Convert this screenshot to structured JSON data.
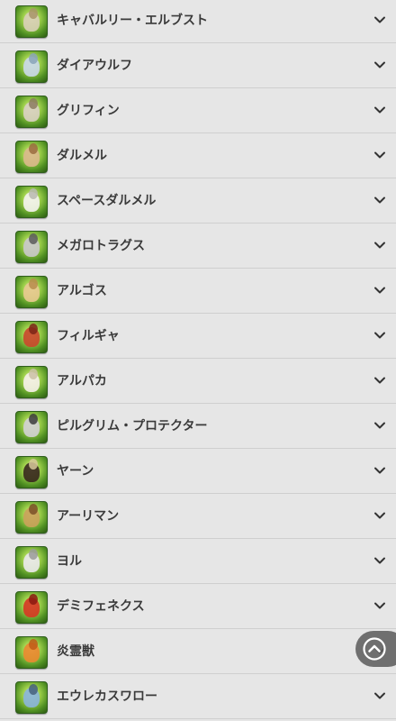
{
  "mounts": [
    {
      "name": "キャバルリー・エルブスト",
      "icon": "elbst-icon",
      "colors": [
        "#d7cfb4",
        "#a89468"
      ]
    },
    {
      "name": "ダイアウルフ",
      "icon": "direwolf-icon",
      "colors": [
        "#c9d8e6",
        "#8aa3b8"
      ]
    },
    {
      "name": "グリフィン",
      "icon": "griffin-icon",
      "colors": [
        "#d8d0c0",
        "#8c7b60"
      ]
    },
    {
      "name": "ダルメル",
      "icon": "dhalmel-icon",
      "colors": [
        "#d9b98a",
        "#9a6c40"
      ]
    },
    {
      "name": "スペースダルメル",
      "icon": "space-dhalmel-icon",
      "colors": [
        "#f2f2ec",
        "#b8b8b0"
      ]
    },
    {
      "name": "メガロトラグス",
      "icon": "megalotragus-icon",
      "colors": [
        "#c8c8c8",
        "#5a5a5a"
      ]
    },
    {
      "name": "アルゴス",
      "icon": "argos-icon",
      "colors": [
        "#e6c98e",
        "#b88c4c"
      ]
    },
    {
      "name": "フィルギャ",
      "icon": "fylgja-icon",
      "colors": [
        "#c84a2c",
        "#7a2416"
      ]
    },
    {
      "name": "アルパカ",
      "icon": "alpaca-icon",
      "colors": [
        "#f4f0e6",
        "#cbbfa6"
      ]
    },
    {
      "name": "ピルグリム・プロテクター",
      "icon": "pilgrim-protector-icon",
      "colors": [
        "#d0d0d0",
        "#3c3c3c"
      ]
    },
    {
      "name": "ヤーン",
      "icon": "yarn-icon",
      "colors": [
        "#3a2a1e",
        "#d8c89a"
      ]
    },
    {
      "name": "アーリマン",
      "icon": "ahriman-icon",
      "colors": [
        "#c9a25a",
        "#7a5028"
      ]
    },
    {
      "name": "ヨル",
      "icon": "yol-icon",
      "colors": [
        "#e8e8e8",
        "#9a9a9a"
      ]
    },
    {
      "name": "デミフェネクス",
      "icon": "demi-phoenix-icon",
      "colors": [
        "#d43a24",
        "#8a1a10"
      ]
    },
    {
      "name": "炎霊獣",
      "icon": "flame-spirit-beast-icon",
      "colors": [
        "#e88a30",
        "#c05a18"
      ]
    },
    {
      "name": "エウレカスワロー",
      "icon": "eureka-swallow-icon",
      "colors": [
        "#8ab4d8",
        "#46607c"
      ]
    }
  ],
  "scroll_top": {
    "icon": "chevron-up-icon"
  },
  "row_icon": "chevron-down-icon",
  "colors": {
    "background": "#e6e6e6",
    "divider": "#cfcfcf",
    "text": "#3a3a3a",
    "thumb_green": "#4f8f22"
  }
}
